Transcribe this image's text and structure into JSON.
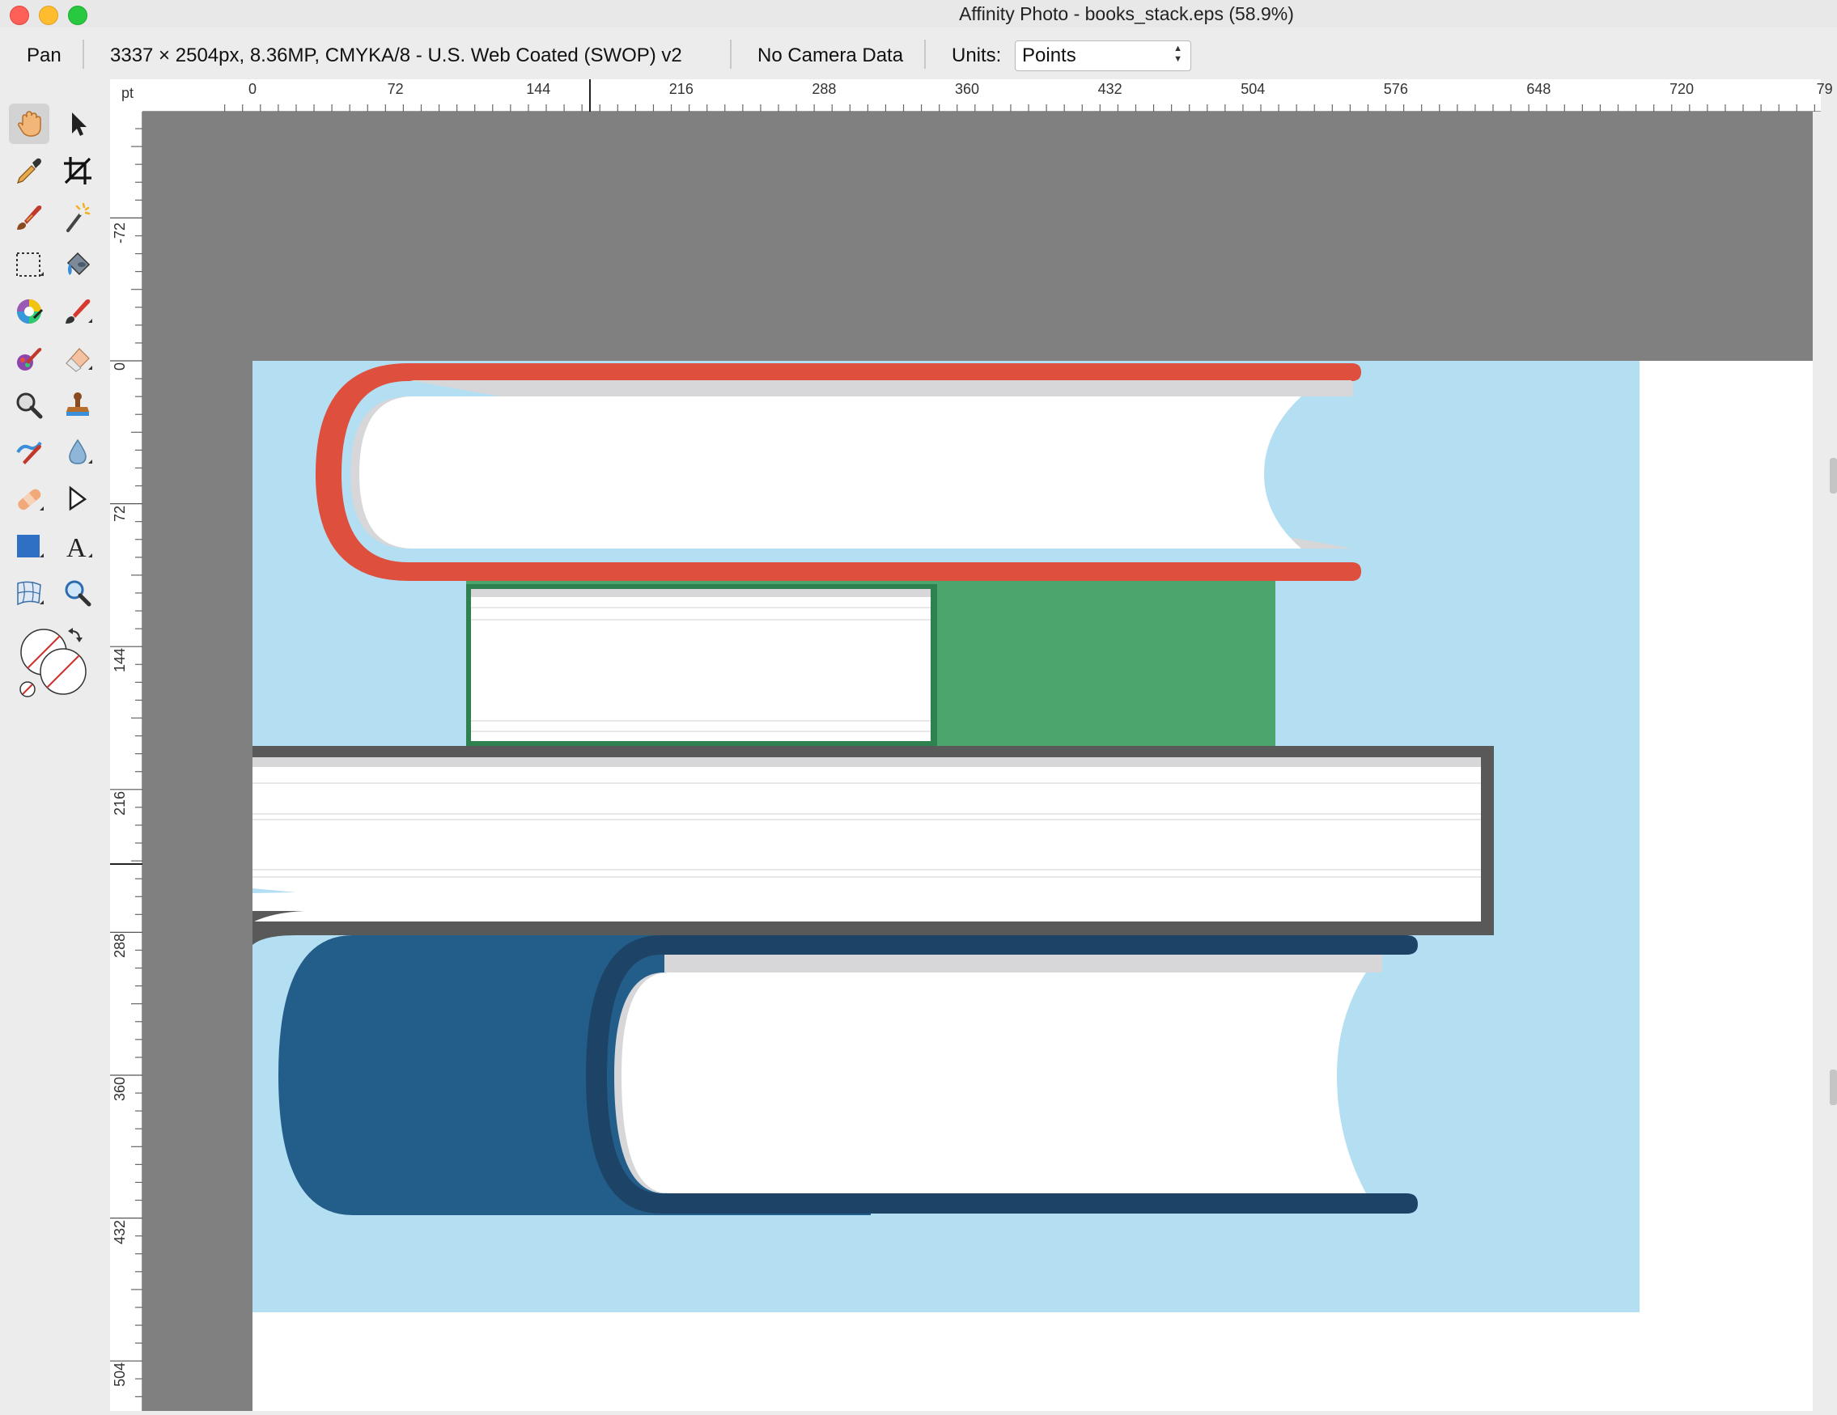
{
  "window": {
    "title": "Affinity Photo - books_stack.eps (58.9%)"
  },
  "context_toolbar": {
    "tool_name": "Pan",
    "document_info": "3337 × 2504px, 8.36MP, CMYKA/8 - U.S. Web Coated (SWOP) v2",
    "camera_info": "No Camera Data",
    "units_label": "Units:",
    "units_value": "Points"
  },
  "ruler": {
    "unit": "pt",
    "top_ticks": [
      "0",
      "72",
      "144",
      "216",
      "288",
      "360",
      "432",
      "504",
      "576",
      "648",
      "720",
      "79"
    ],
    "left_ticks": [
      "-72",
      "0",
      "72",
      "144",
      "216",
      "288",
      "360",
      "432",
      "504"
    ]
  },
  "tools": [
    {
      "name": "pan-tool",
      "icon": "hand-icon",
      "active": true
    },
    {
      "name": "move-tool",
      "icon": "arrow-icon"
    },
    {
      "name": "color-picker-tool",
      "icon": "eyedropper-icon"
    },
    {
      "name": "crop-tool",
      "icon": "crop-icon"
    },
    {
      "name": "selection-brush-tool",
      "icon": "selection-brush-icon"
    },
    {
      "name": "flood-select-tool",
      "icon": "magic-wand-icon"
    },
    {
      "name": "marquee-tool",
      "icon": "marquee-icon"
    },
    {
      "name": "flood-fill-tool",
      "icon": "paint-bucket-icon"
    },
    {
      "name": "color-replacement-tool",
      "icon": "color-wheel-icon"
    },
    {
      "name": "paint-brush-tool",
      "icon": "paint-brush-icon"
    },
    {
      "name": "mixer-brush-tool",
      "icon": "mixer-brush-icon"
    },
    {
      "name": "erase-brush-tool",
      "icon": "eraser-icon"
    },
    {
      "name": "dodge-tool",
      "icon": "dodge-icon"
    },
    {
      "name": "clone-tool",
      "icon": "stamp-icon"
    },
    {
      "name": "smudge-tool",
      "icon": "smudge-icon"
    },
    {
      "name": "blur-tool",
      "icon": "drop-icon"
    },
    {
      "name": "healing-brush-tool",
      "icon": "bandage-icon"
    },
    {
      "name": "node-tool",
      "icon": "node-icon"
    },
    {
      "name": "rectangle-tool",
      "icon": "rectangle-icon"
    },
    {
      "name": "text-tool",
      "icon": "text-icon"
    },
    {
      "name": "mesh-warp-tool",
      "icon": "mesh-warp-icon"
    },
    {
      "name": "zoom-tool",
      "icon": "zoom-icon"
    }
  ],
  "colors": {
    "pasteboard": "#808080",
    "document_background": "#b4dff2",
    "red_book": "#de4f3d",
    "green_book": "#4ba56c",
    "green_book_dark": "#2f8150",
    "gray_book": "#595959",
    "blue_book": "#235e8a",
    "blue_book_dark": "#1d4466",
    "page_shadow": "#d7d7d9"
  }
}
